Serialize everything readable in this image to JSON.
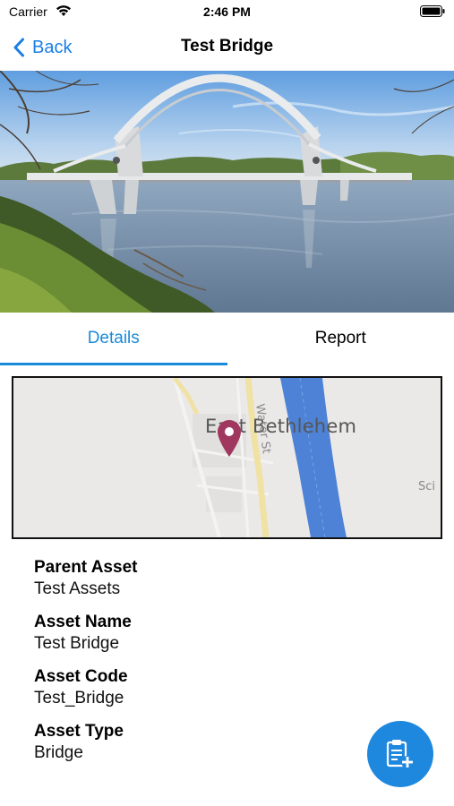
{
  "status_bar": {
    "carrier": "Carrier",
    "time": "2:46 PM",
    "icons": [
      "wifi-icon",
      "battery-icon"
    ]
  },
  "nav": {
    "back_label": "Back",
    "title": "Test Bridge",
    "accent_color": "#1a7ee6"
  },
  "hero": {
    "image": "bridge-photo"
  },
  "tabs": [
    {
      "label": "Details",
      "active": true
    },
    {
      "label": "Report",
      "active": false
    }
  ],
  "map": {
    "place_label": "East Bethlehem",
    "street_label": "Water St",
    "edge_label": "Sci",
    "marker": "map-pin-icon"
  },
  "details": [
    {
      "label": "Parent Asset",
      "value": "Test Assets"
    },
    {
      "label": "Asset Name",
      "value": "Test Bridge"
    },
    {
      "label": "Asset Code",
      "value": "Test_Bridge"
    },
    {
      "label": "Asset Type",
      "value": "Bridge"
    }
  ],
  "fab": {
    "icon": "clipboard-add-icon",
    "color": "#1e88df"
  }
}
